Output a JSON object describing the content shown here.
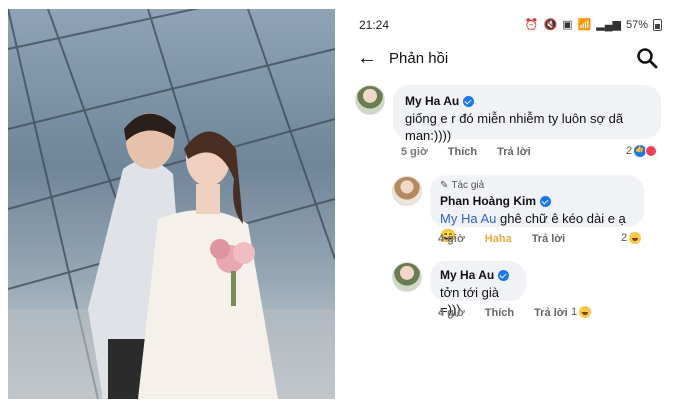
{
  "status_bar": {
    "time": "21:24",
    "battery": "57%",
    "icons": [
      "alarm-icon",
      "mute-icon",
      "sim-icon",
      "wifi-icon",
      "signal-icon",
      "battery-icon"
    ]
  },
  "app_bar": {
    "title": "Phản hồi",
    "back_icon": "arrow-left-icon",
    "search_icon": "search-icon"
  },
  "comments": [
    {
      "author": "My Ha Au",
      "verified": true,
      "text": "giống e r đó miễn nhiễm ty luôn sợ dã man:))))",
      "time": "5 giờ",
      "like_label": "Thích",
      "reply_label": "Trả lời",
      "reaction_count": "2",
      "reactions": [
        "like",
        "heart"
      ]
    },
    {
      "author_badge": "Tác giả",
      "author": "Phan Hoàng Kim",
      "verified": true,
      "mention": "My Ha Au",
      "text": "ghê chữ ê kéo dài e ạ 😄",
      "time": "4 giờ",
      "like_label": "Haha",
      "reply_label": "Trả lời",
      "reaction_count": "2",
      "reactions": [
        "haha"
      ]
    },
    {
      "author": "My Ha Au",
      "verified": true,
      "text": "tởn tới già =)))",
      "time": "4 giờ",
      "like_label": "Thích",
      "reply_label": "Trả lời",
      "reaction_count": "1",
      "reactions": [
        "haha"
      ]
    }
  ],
  "colors": {
    "mention": "#2d63d8",
    "haha_active": "#e8a83e",
    "bubble": "#f0f2f5",
    "verified": "#1877f2"
  }
}
